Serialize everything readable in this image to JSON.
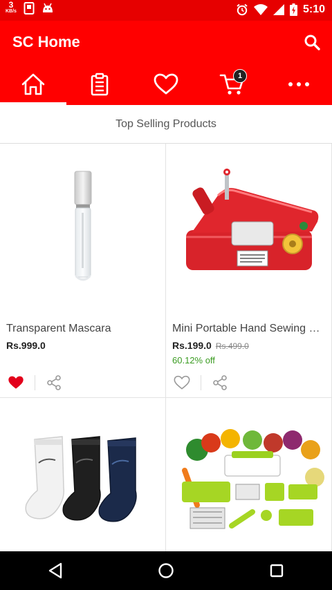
{
  "status_bar": {
    "speed_value": "3",
    "speed_unit": "KB/s",
    "time": "5:10"
  },
  "app_bar": {
    "title": "SC Home",
    "search_icon": "search-icon"
  },
  "tabs": [
    {
      "name": "home",
      "icon": "home-icon",
      "active": true
    },
    {
      "name": "orders",
      "icon": "clipboard-icon",
      "active": false
    },
    {
      "name": "wishlist",
      "icon": "heart-icon",
      "active": false
    },
    {
      "name": "cart",
      "icon": "cart-icon",
      "active": false,
      "badge": "1"
    },
    {
      "name": "more",
      "icon": "more-icon",
      "active": false
    }
  ],
  "section": {
    "title": "Top Selling Products"
  },
  "products": [
    {
      "title": "Transparent Mascara",
      "price": "Rs.999.0",
      "mrp": "",
      "discount": "",
      "wishlisted": true
    },
    {
      "title": "Mini Portable Hand Sewing Machine",
      "price": "Rs.199.0",
      "mrp": "Rs.499.0",
      "discount": "60.12% off",
      "wishlisted": false
    },
    {
      "title": "",
      "price": "",
      "mrp": "",
      "discount": "",
      "wishlisted": false
    },
    {
      "title": "",
      "price": "",
      "mrp": "",
      "discount": "",
      "wishlisted": false
    }
  ],
  "colors": {
    "brand_red": "#ff0000",
    "status_red": "#e60000",
    "wishlist_active": "#e3001b",
    "discount_green": "#3a9b21"
  }
}
